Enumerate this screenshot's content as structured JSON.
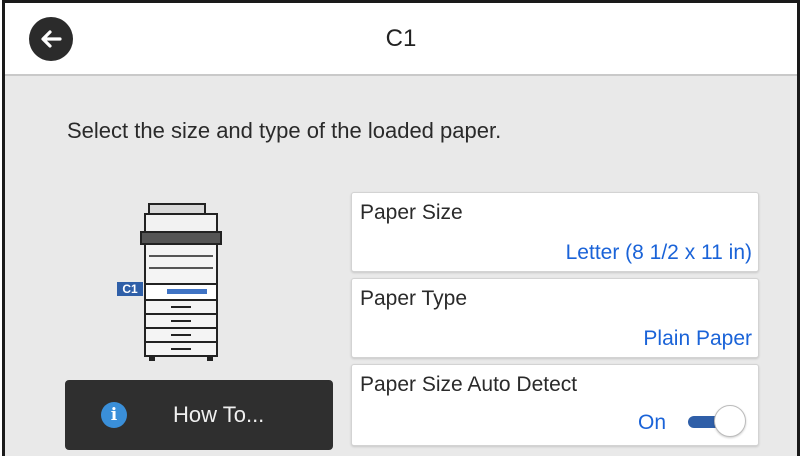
{
  "header": {
    "title": "C1",
    "back_icon": "arrow-left-icon"
  },
  "instructions": "Select the size and type of the loaded paper.",
  "illustration": {
    "tray_label": "C1",
    "icon": "printer-icon"
  },
  "howto_button": {
    "label": "How To...",
    "icon": "info-icon"
  },
  "settings": {
    "paper_size": {
      "label": "Paper Size",
      "value": "Letter (8 1/2 x 11 in)"
    },
    "paper_type": {
      "label": "Paper Type",
      "value": "Plain Paper"
    },
    "auto_detect": {
      "label": "Paper Size Auto Detect",
      "value": "On",
      "enabled": true
    }
  },
  "colors": {
    "value_blue": "#1a63d8",
    "toggle_blue": "#2f5fa8",
    "button_dark": "#2f2f2f",
    "background": "#e9e9e9"
  }
}
